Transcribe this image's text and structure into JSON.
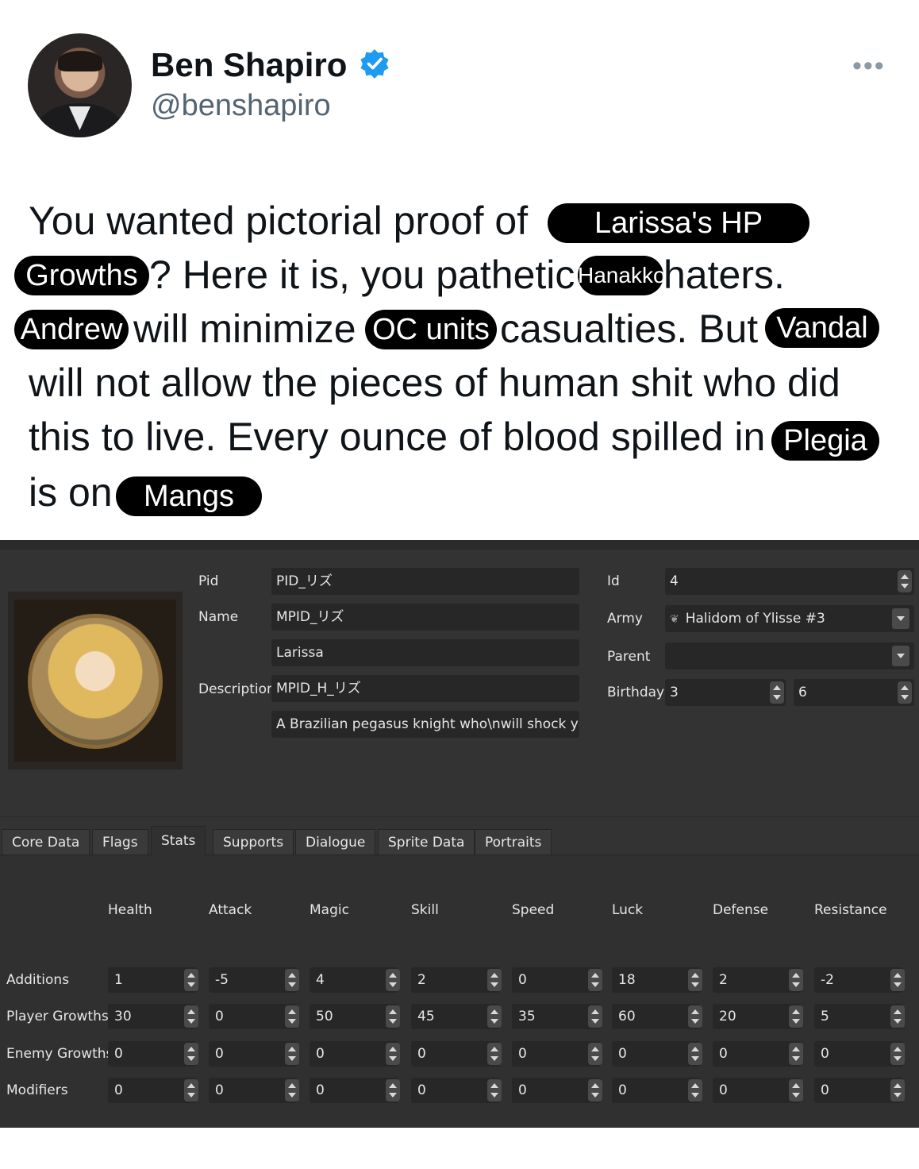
{
  "tweet": {
    "display_name": "Ben Shapiro",
    "handle": "@benshapiro",
    "more_glyph": "•••",
    "lines": {
      "l1a": "You wanted pictorial proof of",
      "r1": "Larissa's HP",
      "r2": "Growths",
      "l2a": "? Here it is, you pathetic",
      "r3": "Hanakko",
      "l2b": "haters.",
      "r4": "Andrew",
      "l3a": "will minimize",
      "r5": "OC units",
      "l3b": "casualties. But",
      "r6": "Vandal",
      "l4": "will not allow the pieces of human shit who did",
      "l5": "this to live. Every ounce of blood spilled in",
      "r7": "Plegia",
      "l6": "is on",
      "r8": "Mangs"
    }
  },
  "editor": {
    "labels": {
      "pid": "Pid",
      "name": "Name",
      "description": "Description",
      "id": "Id",
      "army": "Army",
      "parent": "Parent",
      "birthday": "Birthday"
    },
    "values": {
      "pid": "PID_リズ",
      "name_id": "MPID_リズ",
      "name_text": "Larissa",
      "description_id": "MPID_H_リズ",
      "description_text": "A Brazilian pegasus knight who\\nwill shock you.",
      "id": "4",
      "army": "Halidom of Ylisse #3",
      "parent": "",
      "birthday_month": "3",
      "birthday_day": "6"
    },
    "tabs": [
      "Core Data",
      "Flags",
      "Stats",
      "Supports",
      "Dialogue",
      "Sprite Data",
      "Portraits"
    ],
    "active_tab": "Stats",
    "stats": {
      "columns": [
        "Health",
        "Attack",
        "Magic",
        "Skill",
        "Speed",
        "Luck",
        "Defense",
        "Resistance"
      ],
      "rows": [
        {
          "label": "Additions",
          "values": [
            "1",
            "-5",
            "4",
            "2",
            "0",
            "18",
            "2",
            "-2"
          ]
        },
        {
          "label": "Player Growths",
          "values": [
            "30",
            "0",
            "50",
            "45",
            "35",
            "60",
            "20",
            "5"
          ]
        },
        {
          "label": "Enemy Growths",
          "values": [
            "0",
            "0",
            "0",
            "0",
            "0",
            "0",
            "0",
            "0"
          ]
        },
        {
          "label": "Modifiers",
          "values": [
            "0",
            "0",
            "0",
            "0",
            "0",
            "0",
            "0",
            "0"
          ]
        }
      ]
    }
  },
  "colors": {
    "text": "#0f1419",
    "muted": "#536471",
    "verified": "#1d9bf0",
    "panel_bg": "#333333",
    "field_bg": "#272727"
  }
}
